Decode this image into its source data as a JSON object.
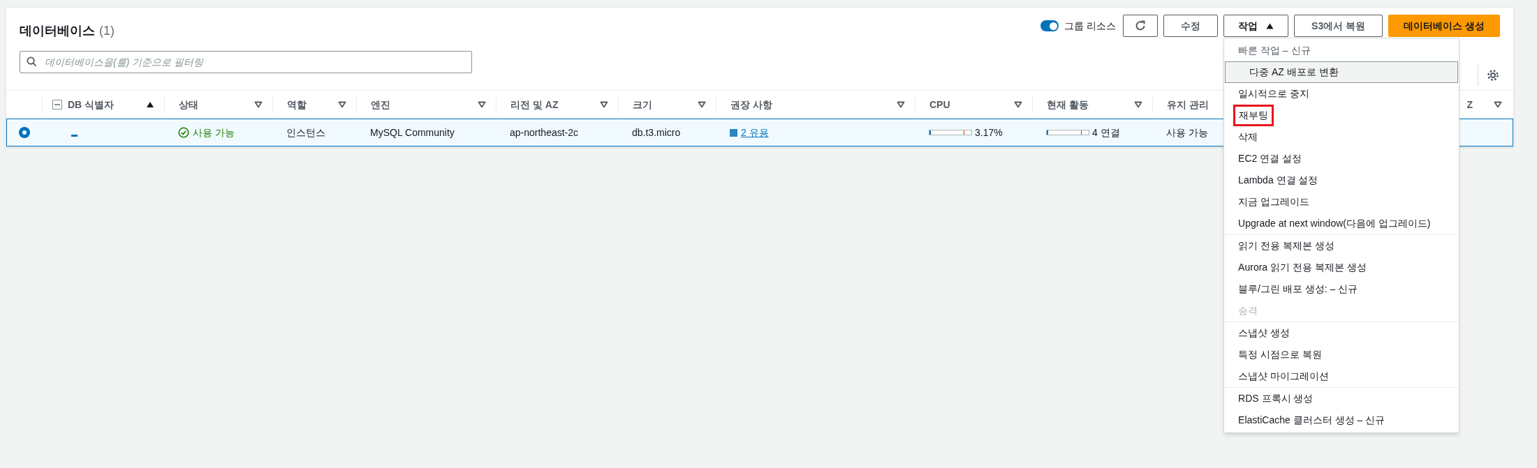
{
  "header": {
    "title": "데이터베이스",
    "count": "(1)",
    "group_toggle": {
      "label": "그룹 리소스",
      "on": true
    },
    "buttons": [
      {
        "kind": "refresh"
      },
      {
        "kind": "normal",
        "label": "수정"
      },
      {
        "kind": "menu",
        "label": "작업",
        "expanded": true
      },
      {
        "kind": "normal",
        "label": "S3에서 복원"
      },
      {
        "kind": "primary",
        "label": "데이터베이스 생성"
      }
    ]
  },
  "filter": {
    "placeholder": "데이터베이스을(를) 기준으로 필터링"
  },
  "table": {
    "columns": [
      {
        "kind": "select"
      },
      {
        "kind": "id",
        "label": "DB 식별자",
        "sorted": true,
        "select_all_indeterminate": true
      },
      {
        "kind": "text",
        "label": "상태",
        "sorted": false
      },
      {
        "kind": "text",
        "label": "역할",
        "sorted": false
      },
      {
        "kind": "text",
        "label": "엔진",
        "sorted": false
      },
      {
        "kind": "text",
        "label": "리전 및 AZ",
        "sorted": false
      },
      {
        "kind": "text",
        "label": "크기",
        "sorted": false
      },
      {
        "kind": "text",
        "label": "권장 사항",
        "sorted": false
      },
      {
        "kind": "text",
        "label": "CPU",
        "sorted": false
      },
      {
        "kind": "text",
        "label": "현재 활동",
        "sorted": false
      },
      {
        "kind": "text",
        "label": "유지 관리"
      },
      {
        "kind": "tail",
        "label": "Z",
        "sorted": false
      }
    ],
    "rows": [
      {
        "selected": true,
        "cells": [
          {
            "kind": "radio"
          },
          {
            "kind": "redacted"
          },
          {
            "kind": "status",
            "text": "사용 가능"
          },
          {
            "kind": "text",
            "text": "인스턴스"
          },
          {
            "kind": "text",
            "text": "MySQL Community"
          },
          {
            "kind": "text",
            "text": "ap-northeast-2c"
          },
          {
            "kind": "text",
            "text": "db.t3.micro"
          },
          {
            "kind": "recommendation",
            "text": "2 유용"
          },
          {
            "kind": "meter",
            "level": 0.03,
            "text": "3.17%"
          },
          {
            "kind": "meter",
            "level": 0.03,
            "text": "4 연결"
          },
          {
            "kind": "text",
            "text": "사용 가능"
          }
        ]
      }
    ]
  },
  "menu": {
    "groups": [
      [
        {
          "label": "빠른 작업 – 신규",
          "kind": "heading",
          "children": [
            {
              "label": "다중 AZ 배포로 변환",
              "kind": "option",
              "highlighted": true,
              "disabled": false,
              "marked": false
            }
          ]
        },
        {
          "label": "일시적으로 중지",
          "kind": "option",
          "highlighted": false,
          "disabled": false,
          "marked": false
        },
        {
          "label": "재부팅",
          "kind": "option",
          "highlighted": false,
          "disabled": false,
          "marked": true
        },
        {
          "label": "삭제",
          "kind": "option",
          "highlighted": false,
          "disabled": false,
          "marked": false
        },
        {
          "label": "EC2 연결 설정",
          "kind": "option",
          "highlighted": false,
          "disabled": false,
          "marked": false
        },
        {
          "label": "Lambda 연결 설정",
          "kind": "option",
          "highlighted": false,
          "disabled": false,
          "marked": false
        },
        {
          "label": "지금 업그레이드",
          "kind": "option",
          "highlighted": false,
          "disabled": false,
          "marked": false
        },
        {
          "label": "Upgrade at next window(다음에 업그레이드)",
          "kind": "option",
          "highlighted": false,
          "disabled": false,
          "marked": false
        }
      ],
      [
        {
          "label": "읽기 전용 복제본 생성",
          "kind": "option",
          "highlighted": false,
          "disabled": false,
          "marked": false
        },
        {
          "label": "Aurora 읽기 전용 복제본 생성",
          "kind": "option",
          "highlighted": false,
          "disabled": false,
          "marked": false
        },
        {
          "label": "블루/그린 배포 생성: – 신규",
          "kind": "option",
          "highlighted": false,
          "disabled": false,
          "marked": false
        },
        {
          "label": "승격",
          "kind": "option",
          "highlighted": false,
          "disabled": true,
          "marked": false
        }
      ],
      [
        {
          "label": "스냅샷 생성",
          "kind": "option",
          "highlighted": false,
          "disabled": false,
          "marked": false
        },
        {
          "label": "특정 시점으로 복원",
          "kind": "option",
          "highlighted": false,
          "disabled": false,
          "marked": false
        },
        {
          "label": "스냅샷 마이그레이션",
          "kind": "option",
          "highlighted": false,
          "disabled": false,
          "marked": false
        }
      ],
      [
        {
          "label": "RDS 프록시 생성",
          "kind": "option",
          "highlighted": false,
          "disabled": false,
          "marked": false
        },
        {
          "label": "ElastiCache 클러스터 생성 – 신규",
          "kind": "option",
          "highlighted": false,
          "disabled": false,
          "marked": false
        }
      ]
    ]
  }
}
